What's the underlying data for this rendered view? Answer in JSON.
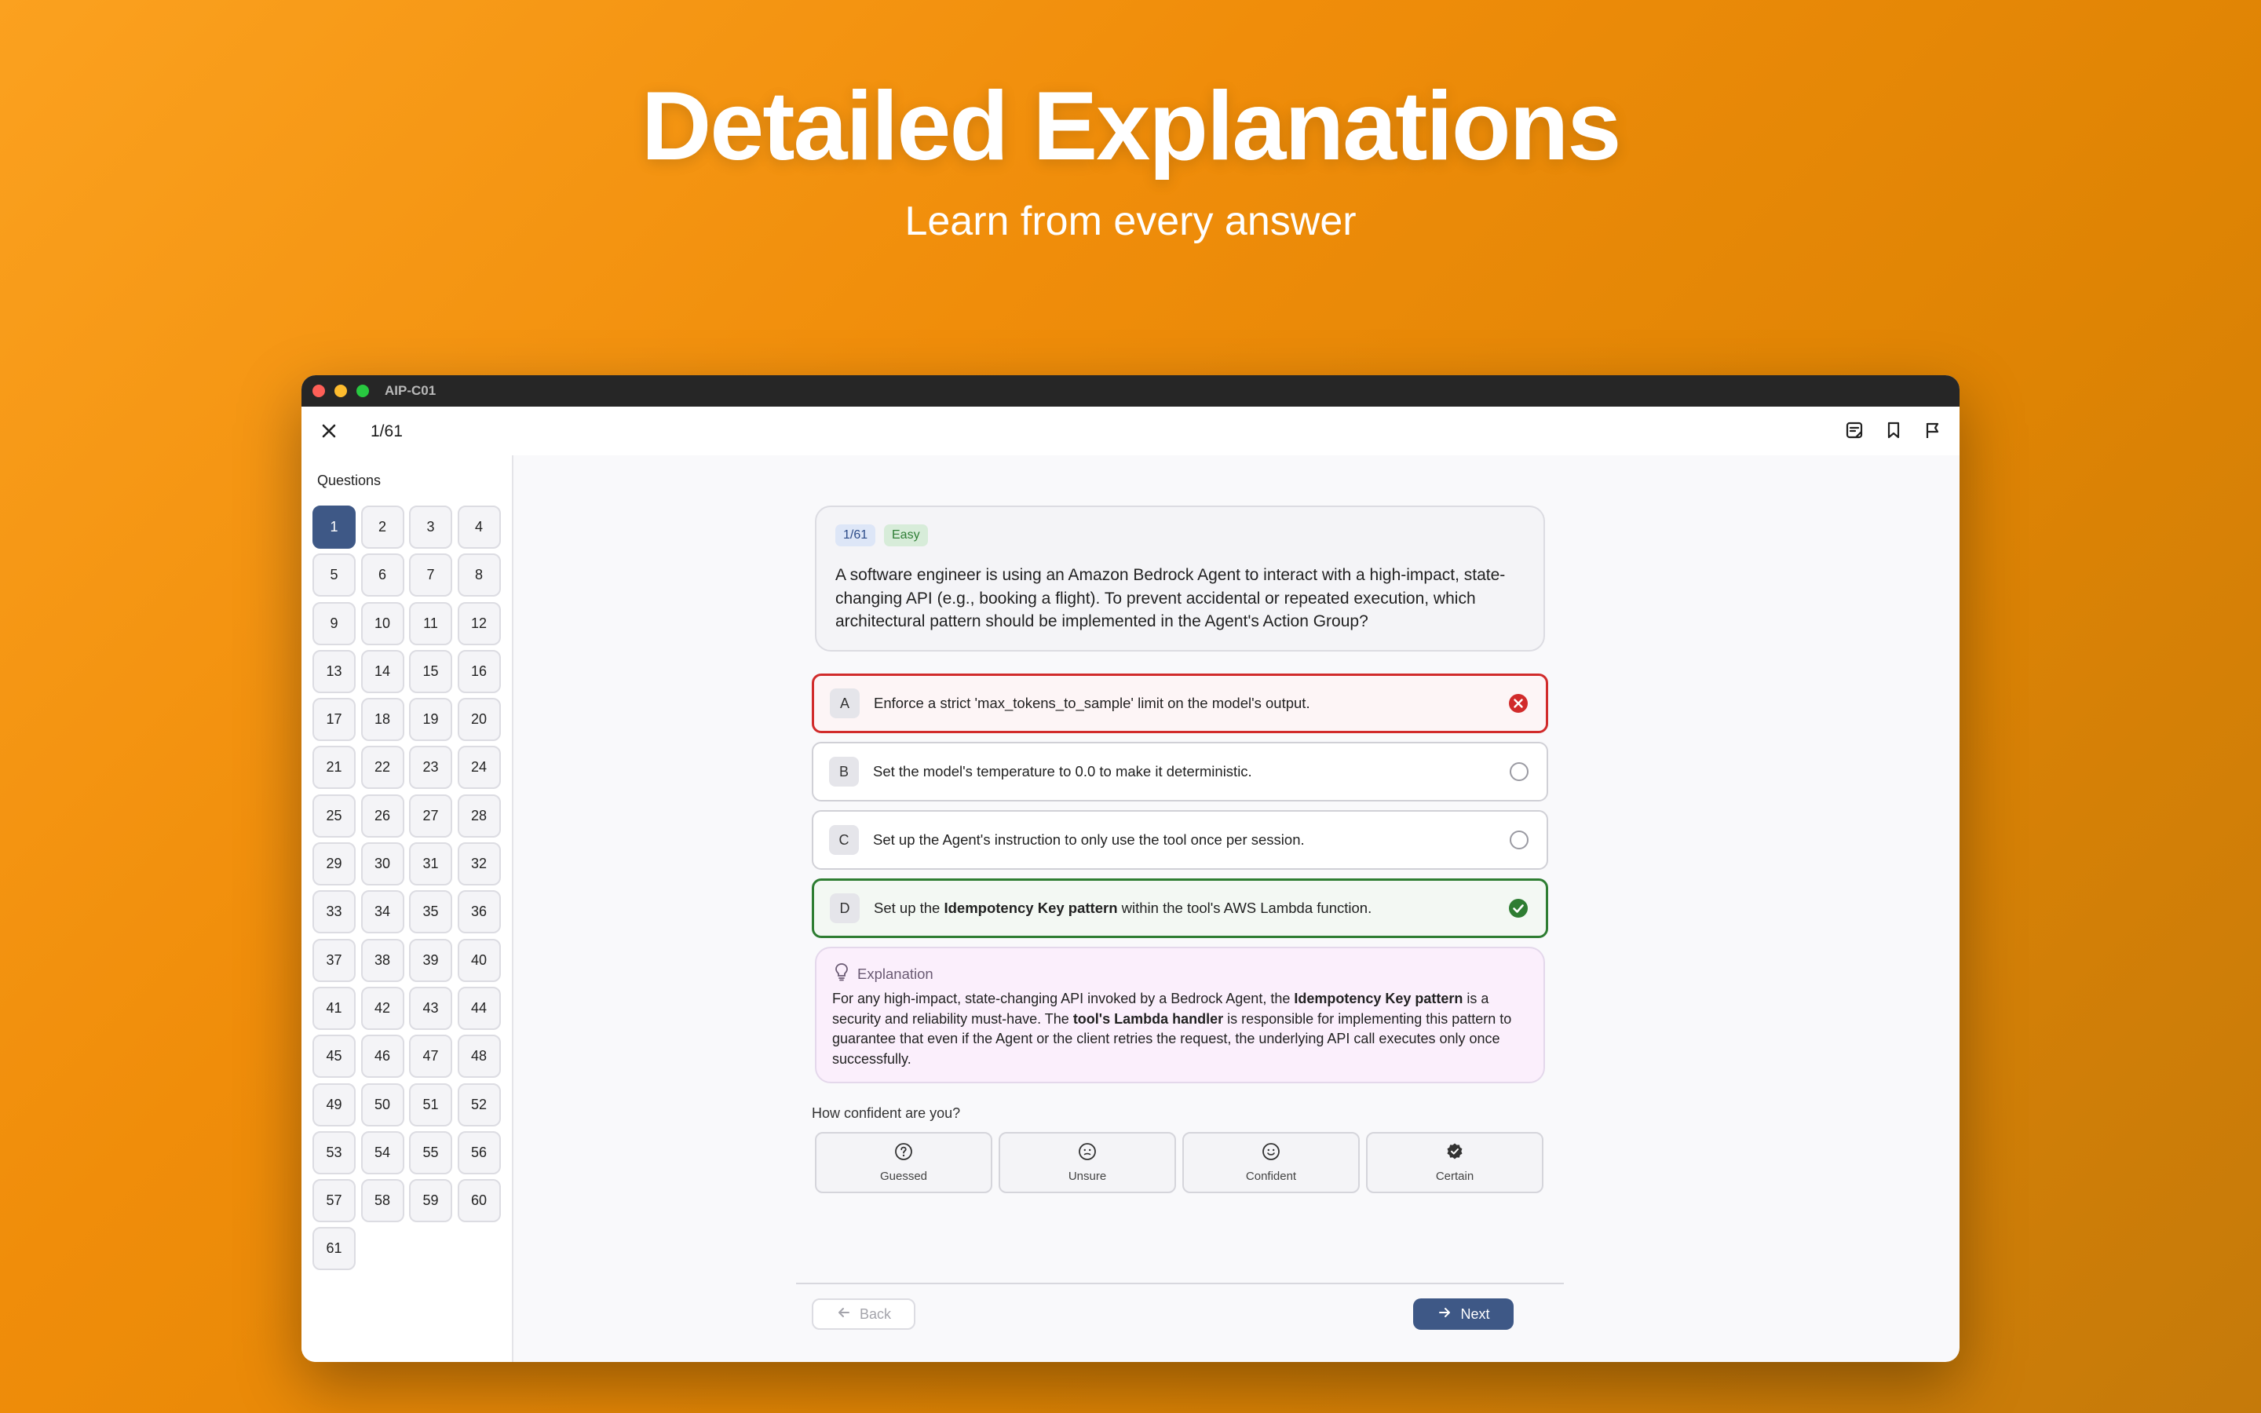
{
  "hero": {
    "title": "Detailed Explanations",
    "subtitle": "Learn from every answer"
  },
  "window": {
    "title": "AIP-C01"
  },
  "topbar": {
    "progress": "1/61",
    "icons": [
      "close-icon",
      "notes-icon",
      "bookmark-icon",
      "flag-icon"
    ]
  },
  "sidebar": {
    "heading": "Questions",
    "active": "1",
    "items": [
      "1",
      "2",
      "3",
      "4",
      "5",
      "6",
      "7",
      "8",
      "9",
      "10",
      "11",
      "12",
      "13",
      "14",
      "15",
      "16",
      "17",
      "18",
      "19",
      "20",
      "21",
      "22",
      "23",
      "24",
      "25",
      "26",
      "27",
      "28",
      "29",
      "30",
      "31",
      "32",
      "33",
      "34",
      "35",
      "36",
      "37",
      "38",
      "39",
      "40",
      "41",
      "42",
      "43",
      "44",
      "45",
      "46",
      "47",
      "48",
      "49",
      "50",
      "51",
      "52",
      "53",
      "54",
      "55",
      "56",
      "57",
      "58",
      "59",
      "60",
      "61"
    ]
  },
  "question": {
    "number_badge": "1/61",
    "difficulty": "Easy",
    "text": "A software engineer is using an Amazon Bedrock Agent to interact with a high-impact, state-changing API (e.g., booking a flight). To prevent accidental or repeated execution, which architectural pattern should be implemented in the Agent's Action Group?"
  },
  "options": [
    {
      "letter": "A",
      "text": "Enforce a strict 'max_tokens_to_sample' limit on the model's output.",
      "state": "wrong"
    },
    {
      "letter": "B",
      "text": "Set the model's temperature to 0.0 to make it deterministic.",
      "state": "unselected"
    },
    {
      "letter": "C",
      "text": "Set up the Agent's instruction to only use the tool once per session.",
      "state": "unselected"
    },
    {
      "letter": "D",
      "text_before": "Set up the ",
      "text_bold": "Idempotency Key pattern",
      "text_after": " within the tool's AWS Lambda function.",
      "state": "correct"
    }
  ],
  "explanation": {
    "heading": "Explanation",
    "p1": "For any high-impact, state-changing API invoked by a Bedrock Agent, the ",
    "b1": "Idempotency Key pattern",
    "p2": " is a security and reliability must-have. The ",
    "b2": "tool's Lambda handler",
    "p3": " is responsible for implementing this pattern to guarantee that even if the Agent or the client retries the request, the underlying API call executes only once successfully."
  },
  "confidence": {
    "label": "How confident are you?",
    "options": [
      {
        "label": "Guessed",
        "icon": "question-circle-icon"
      },
      {
        "label": "Unsure",
        "icon": "neutral-face-icon"
      },
      {
        "label": "Confident",
        "icon": "smile-face-icon"
      },
      {
        "label": "Certain",
        "icon": "verified-badge-icon"
      }
    ]
  },
  "nav": {
    "back_label": "Back",
    "next_label": "Next"
  },
  "colors": {
    "accent": "#3e5886",
    "wrong": "#d12b2b",
    "correct": "#2e7d32",
    "background_orange": "#f08d0a"
  }
}
